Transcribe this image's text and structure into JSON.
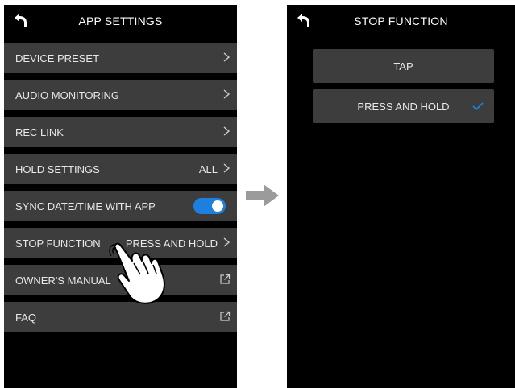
{
  "left_screen": {
    "title": "APP SETTINGS",
    "items": [
      {
        "label": "DEVICE PRESET",
        "value": "",
        "indicator": "chevron-right-icon"
      },
      {
        "label": "AUDIO MONITORING",
        "value": "",
        "indicator": "chevron-right-icon"
      },
      {
        "label": "REC LINK",
        "value": "",
        "indicator": "chevron-right-icon"
      },
      {
        "label": "HOLD SETTINGS",
        "value": "ALL",
        "indicator": "chevron-right-icon"
      },
      {
        "label": "SYNC DATE/TIME WITH APP",
        "value": "",
        "indicator": "toggle-switch",
        "toggle_on": true
      },
      {
        "label": "STOP FUNCTION",
        "value": "PRESS AND HOLD",
        "indicator": "chevron-right-icon"
      },
      {
        "label": "OWNER'S MANUAL",
        "value": "",
        "indicator": "external-link-icon"
      },
      {
        "label": "FAQ",
        "value": "",
        "indicator": "external-link-icon"
      }
    ]
  },
  "right_screen": {
    "title": "STOP FUNCTION",
    "options": [
      {
        "label": "TAP",
        "selected": false
      },
      {
        "label": "PRESS AND HOLD",
        "selected": true
      }
    ]
  },
  "icons": {
    "back": "back-arrow-icon",
    "transition": "right-arrow-icon",
    "pointer": "tapping-hand-icon",
    "selected": "checkmark-icon"
  },
  "colors": {
    "screen_background": "#000000",
    "row_background": "#3d3d3d",
    "text": "#e8e8e8",
    "accent": "#1f7fe0",
    "transition_arrow": "#9b9b9b"
  }
}
